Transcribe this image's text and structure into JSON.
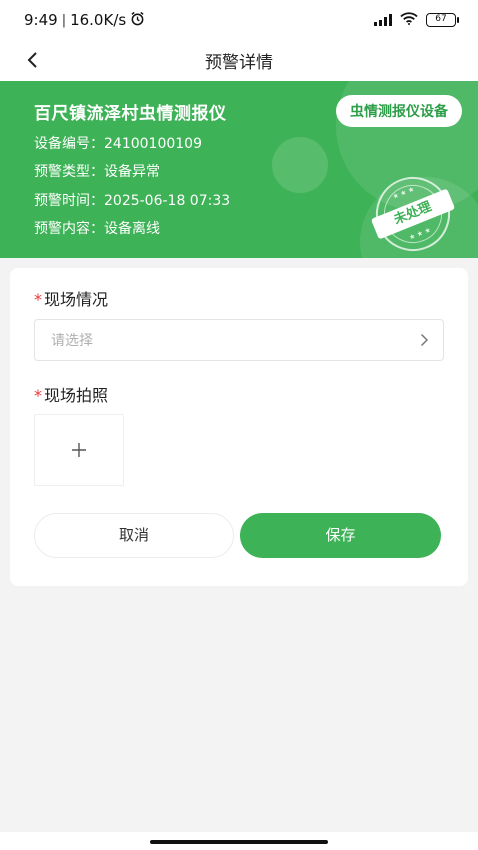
{
  "status_bar": {
    "time": "9:49",
    "network_speed": "16.0K/s",
    "battery": "67",
    "icons": [
      "alarm-icon",
      "signal-icon",
      "wifi-icon",
      "battery-icon"
    ]
  },
  "nav": {
    "title": "预警详情",
    "back_icon": "chevron-left-icon"
  },
  "header": {
    "title": "百尺镇流泽村虫情测报仪",
    "device_badge": "虫情测报仪设备",
    "device_no": "设备编号：24100100109",
    "alert_type": "预警类型：设备异常",
    "alert_time": "预警时间：2025-06-18 07:33",
    "alert_content": "预警内容：设备离线",
    "stamp": "未处理",
    "accent_color": "#3db256"
  },
  "form": {
    "scene_label": "现场情况",
    "scene_placeholder": "请选择",
    "photo_label": "现场拍照",
    "required_mark": "*",
    "upload_icon": "plus-icon",
    "cancel_label": "取消",
    "save_label": "保存"
  }
}
